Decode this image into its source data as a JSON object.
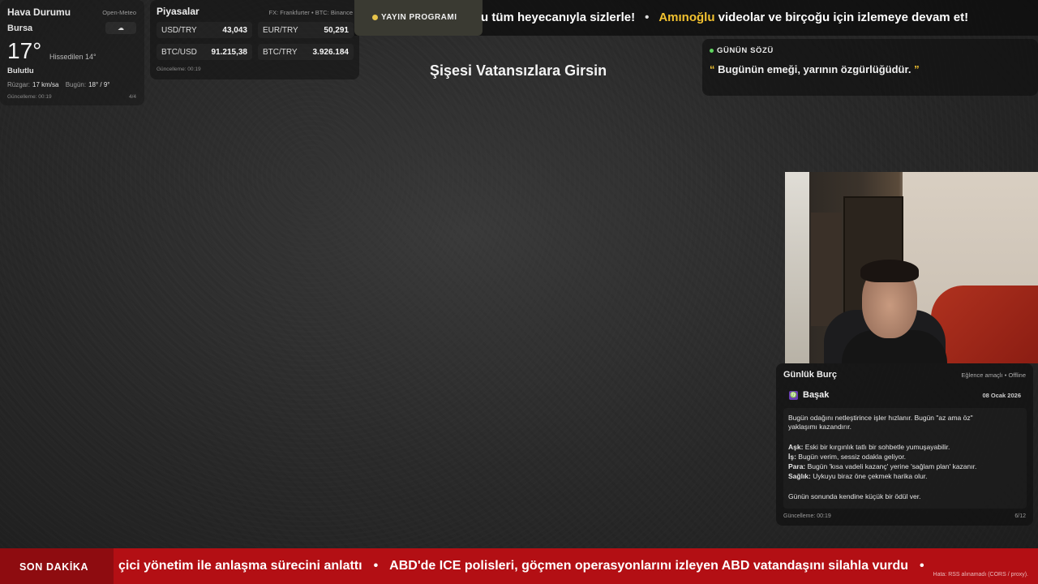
{
  "weather": {
    "title": "Hava Durumu",
    "source": "Open-Meteo",
    "city": "Bursa",
    "icon": "cloud-icon",
    "temperature": "17°",
    "feels_like": "Hissedilen 14°",
    "condition": "Bulutlu",
    "wind_label": "Rüzgar:",
    "wind_value": "17 km/sa",
    "today_label": "Bugün:",
    "today_value": "18° / 9°",
    "updated": "Güncelleme: 00:19",
    "page": "4/4"
  },
  "markets": {
    "title": "Piyasalar",
    "source": "FX: Frankfurter • BTC: Binance",
    "items": [
      {
        "pair": "USD/TRY",
        "value": "43,043"
      },
      {
        "pair": "EUR/TRY",
        "value": "50,291"
      },
      {
        "pair": "BTC/USD",
        "value": "91.215,38"
      },
      {
        "pair": "BTC/TRY",
        "value": "3.926.184"
      }
    ],
    "updated": "Güncelleme: 00:19"
  },
  "top_ticker": {
    "badge": "YAYIN PROGRAMI",
    "text_1": "u tüm heyecanıyla sizlerle!",
    "separator": "•",
    "highlight": "Amınoğlu",
    "text_2": " videolar ve birçoğu için izlemeye devam et!"
  },
  "stream_title": "Şişesi Vatansızlara Girsin",
  "quote": {
    "header": "GÜNÜN SÖZÜ",
    "open_mark": "“",
    "text": " Bugünün emeği, yarının özgürlüğüdür. ",
    "close_mark": "”"
  },
  "horoscope": {
    "title": "Günlük Burç",
    "subtitle": "Eğlence amaçlı • Offline",
    "sign_icon": "♍",
    "sign": "Başak",
    "date": "08 Ocak 2026",
    "intro": "Bugün odağını netleştirince işler hızlanır. Bugün \"az ama öz\"",
    "intro_2": "yaklaşımı kazandırır.",
    "love_label": "Aşk:",
    "love": " Eski bir kırgınlık tatlı bir sohbetle yumuşayabilir.",
    "work_label": "İş:",
    "work": " Bugün verim, sessiz odakla geliyor.",
    "money_label": "Para:",
    "money": " Bugün 'kısa vadeli kazanç' yerine 'sağlam plan' kazanır.",
    "health_label": "Sağlık:",
    "health": " Uykuyu biraz öne çekmek harika olur.",
    "closing": "Günün sonunda kendine küçük bir ödül ver.",
    "updated": "Güncelleme: 00:19",
    "page": "6/12"
  },
  "bottom_ticker": {
    "badge": "SON DAKİKA",
    "item_1": "çici yönetim ile anlaşma sürecini anlattı",
    "separator": "•",
    "item_2": "ABD'de ICE polisleri, göçmen operasyonlarını izleyen ABD vatandaşını silahla vurdu",
    "separator_2": "•",
    "error": "Hata: RSS alınamadı (CORS / proxy)."
  },
  "colors": {
    "accent": "#f2c230",
    "breaking": "#b30f14",
    "live_dot": "#5fd45f"
  }
}
